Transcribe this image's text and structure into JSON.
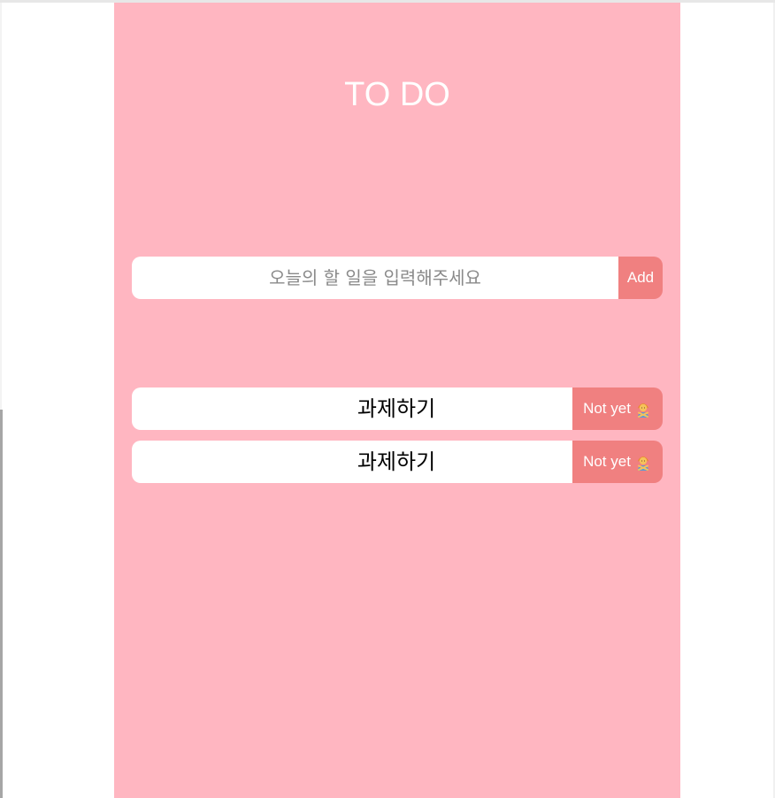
{
  "app": {
    "title": "TO DO"
  },
  "form": {
    "input_placeholder": "오늘의 할 일을 입력해주세요",
    "input_value": "",
    "add_label": "Add"
  },
  "todos": [
    {
      "text": "과제하기",
      "status_label": "Not yet",
      "status_icon": "person-gesturing-no-icon"
    },
    {
      "text": "과제하기",
      "status_label": "Not yet",
      "status_icon": "person-gesturing-no-icon"
    }
  ],
  "colors": {
    "background": "#ffb6c1",
    "accent": "#f08080",
    "text_light": "#ffffff"
  }
}
